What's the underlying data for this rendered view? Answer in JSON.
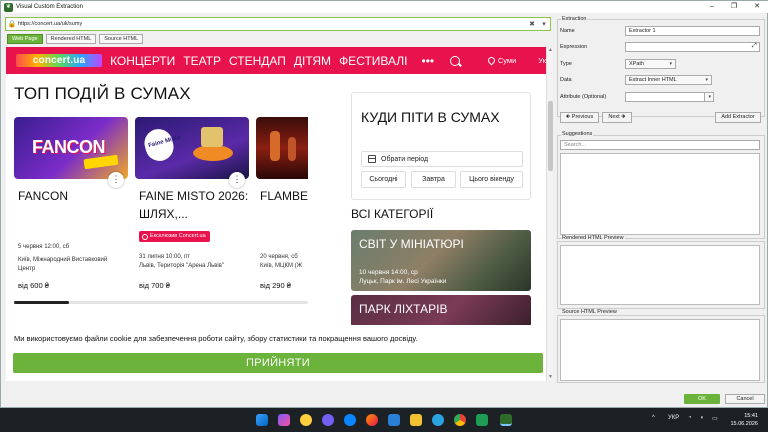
{
  "window": {
    "title": "Visual Custom Extraction",
    "minimize": "–",
    "maximize": "❐",
    "close": "✕"
  },
  "urlbar": {
    "url": "https://concert.ua/uk/sumy",
    "clear_icon": "✖",
    "dropdown_icon": "▾"
  },
  "view_tabs": [
    "Web Page",
    "Rendered HTML",
    "Source HTML"
  ],
  "site": {
    "logo": "concert.ua",
    "nav": [
      "КОНЦЕРТИ",
      "ТЕАТР",
      "СТЕНДАП",
      "ДІТЯМ",
      "ФЕСТИВАЛІ"
    ],
    "more": "•••",
    "city": "Суми",
    "nav_cut": "Ук",
    "heading": "ТОП ПОДІЙ В СУМАХ",
    "cards": [
      {
        "title": "FANCON",
        "date": "5 червня 12:00, сб",
        "place": "Київ, Міжнародний Виставковий Центр",
        "price": "від 600 ₴",
        "img_text": "FANCON"
      },
      {
        "title": "FAINE MISTO 2026: ШЛЯХ,...",
        "badge": "Ексклюзив Concert.ua",
        "date": "31 липня 10:00, пт",
        "place": "Львів, Територія \"Арена Львів\"",
        "price": "від 700 ₴",
        "img_text": "Faine Misto"
      },
      {
        "title": "FLAMBE",
        "date": "20 червня, сб",
        "place": "Київ, МЦКМ (Ж",
        "price": "від 290 ₴",
        "img_text": ""
      }
    ],
    "side": {
      "title": "КУДИ ПІТИ В СУМАХ",
      "period": "Обрати період",
      "today": "Сьогодні",
      "tomorrow": "Завтра",
      "weekend": "Цього вікенду"
    },
    "categories_title": "ВСІ КАТЕГОРІЇ",
    "categories": [
      {
        "title": "СВІТ У МІНІАТЮРІ",
        "date": "10 червня 14:00, ср",
        "place": "Луцьк, Парк ім. Лесі Українки"
      },
      {
        "title": "ПАРК ЛІХТАРІВ"
      }
    ],
    "cookie": {
      "text": "Ми використовуємо файли cookie для забезпечення роботи сайту, збору статистики та покращення вашого досвіду.",
      "accept": "ПРИЙНЯТИ"
    }
  },
  "extraction": {
    "group": "Extraction",
    "name_label": "Name",
    "name_value": "Extractor 1",
    "expression_label": "Expression",
    "expression_value": "",
    "type_label": "Type",
    "type_value": "XPath",
    "data_label": "Data",
    "data_value": "Extract Inner HTML",
    "attribute_label": "Attribute (Optional)",
    "attribute_value": "",
    "previous": "Previous",
    "next": "Next",
    "add": "Add Extractor",
    "suggestions": "Suggestions",
    "search_placeholder": "Search...",
    "rendered_preview": "Rendered HTML Preview",
    "source_preview": "Source HTML Preview",
    "ok": "OK",
    "cancel": "Cancel"
  },
  "taskbar": {
    "lang": "УКР",
    "time": "15:41",
    "date": "15.06.2026",
    "chevron": "^"
  }
}
